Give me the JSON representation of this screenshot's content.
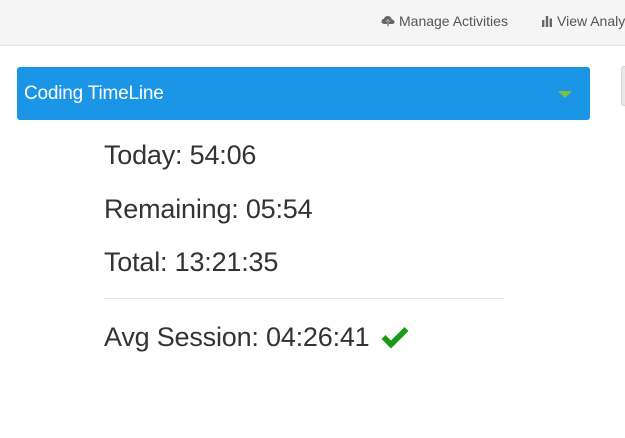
{
  "toolbar": {
    "manage_activities": {
      "label": "Manage Activities",
      "icon": "cloud-upload-icon"
    },
    "view_analytics": {
      "label": "View Analy",
      "icon": "bar-chart-icon"
    }
  },
  "panel": {
    "title": "Coding TimeLine",
    "toggle_icon": "caret-down-icon",
    "accent_color": "#1b96e6",
    "caret_color": "#7cc242"
  },
  "stats": {
    "today": "Today: 54:06",
    "remaining": "Remaining: 05:54",
    "total": "Total: 13:21:35",
    "avg_session": "Avg Session: 04:26:41",
    "avg_status_icon": "checkmark-icon",
    "check_color": "#1a9a1a"
  }
}
